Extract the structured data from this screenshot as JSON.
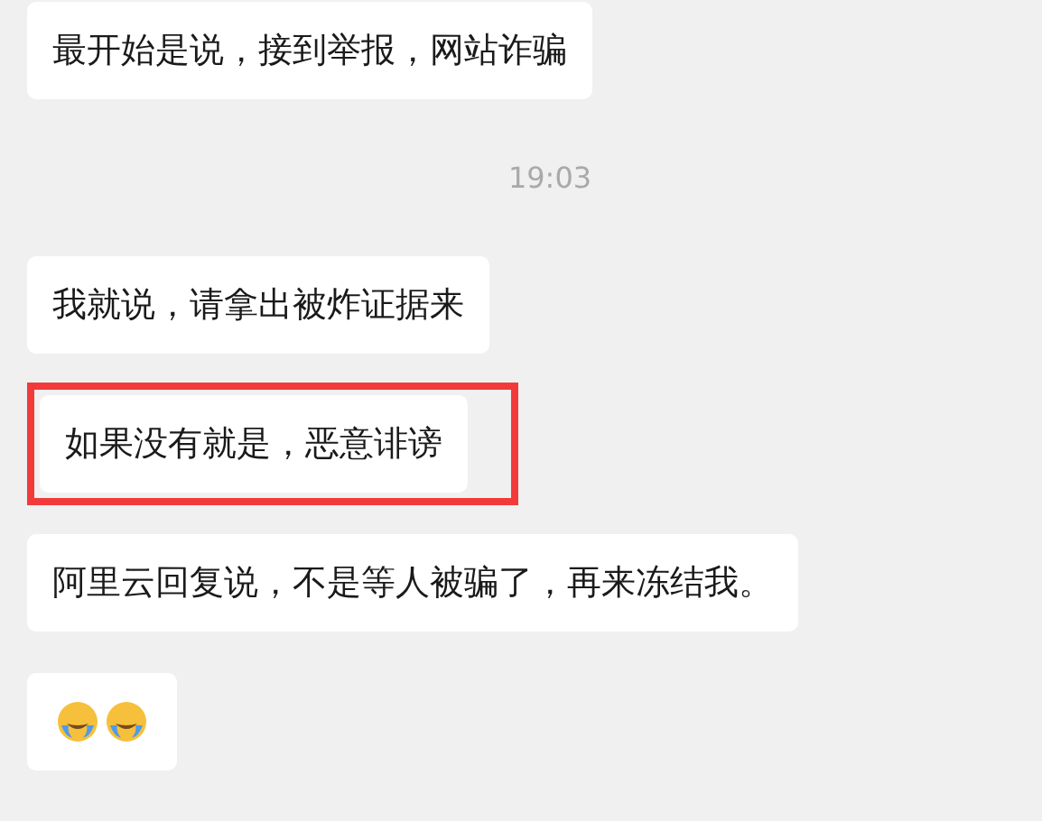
{
  "messages": [
    {
      "kind": "text",
      "text": "最开始是说，接到举报，网站诈骗",
      "highlighted": false
    },
    {
      "kind": "time",
      "text": "19:03"
    },
    {
      "kind": "text",
      "text": "我就说，请拿出被炸证据来",
      "highlighted": false
    },
    {
      "kind": "text",
      "text": "如果没有就是，恶意诽谤",
      "highlighted": true
    },
    {
      "kind": "text",
      "text": "阿里云回复说，不是等人被骗了，再来冻结我。",
      "highlighted": false
    },
    {
      "kind": "emoji",
      "emojis": [
        {
          "kind": "emoji"
        },
        {
          "kind": "emoji"
        }
      ],
      "highlighted": false
    }
  ]
}
